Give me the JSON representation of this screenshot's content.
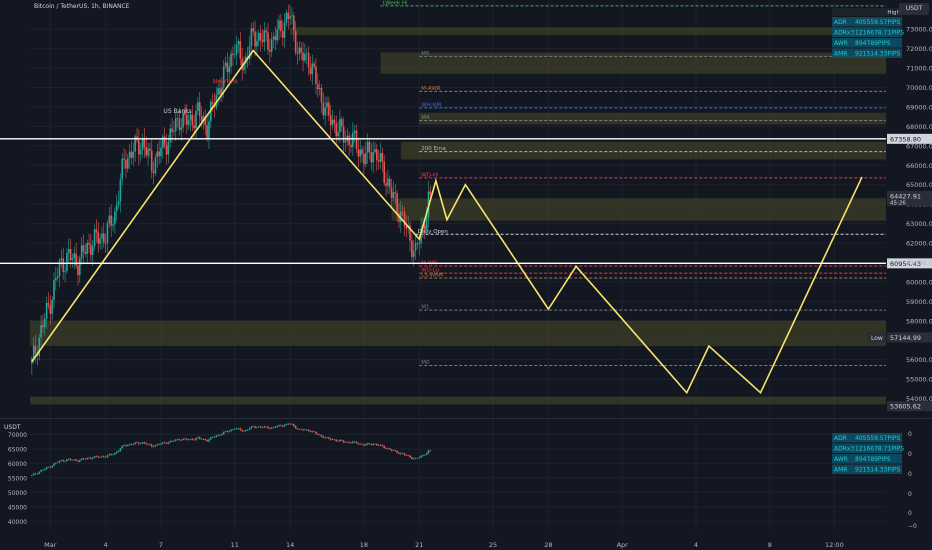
{
  "header": {
    "symbol_line": "Bitcoin / TetherUS, 1h, BINANCE",
    "currency": "USDT",
    "sub_currency": "USDT"
  },
  "stats": {
    "title": "High",
    "rows": [
      {
        "label": "ADR",
        "value": "405559.57PIPS"
      },
      {
        "label": "ADRx3",
        "value": "1216678.71PIPS"
      },
      {
        "label": "AWR",
        "value": "894789PIPS"
      },
      {
        "label": "AMR",
        "value": "921514.33PIPS"
      }
    ]
  },
  "chart_data": [
    {
      "type": "candlestick",
      "title": "Bitcoin / TetherUS, 1h, BINANCE",
      "ylabel": "USDT",
      "ylim": [
        53000,
        74500
      ],
      "y_ticks": [
        54000,
        55000,
        56000,
        57000,
        58000,
        59000,
        60000,
        61000,
        62000,
        63000,
        64000,
        65000,
        66000,
        67000,
        68000,
        69000,
        70000,
        71000,
        72000,
        73000
      ],
      "x_ticks": [
        "Mar",
        "4",
        "7",
        "11",
        "14",
        "18",
        "21",
        "25",
        "28",
        "Apr",
        "4",
        "8",
        "12:00"
      ],
      "x_tick_day": [
        0,
        3,
        6,
        10,
        13,
        17,
        20,
        24,
        27,
        31,
        35,
        39,
        42.5
      ],
      "xlim": [
        -1.1,
        45.3
      ],
      "close_path": [
        [
          -1.0,
          55800
        ],
        [
          -0.5,
          57500
        ],
        [
          0,
          59000
        ],
        [
          0.5,
          60800
        ],
        [
          1,
          61300
        ],
        [
          1.5,
          61000
        ],
        [
          2,
          61800
        ],
        [
          2.5,
          62200
        ],
        [
          3,
          62400
        ],
        [
          3.5,
          63500
        ],
        [
          4,
          66200
        ],
        [
          4.5,
          66800
        ],
        [
          5,
          67200
        ],
        [
          5.5,
          66000
        ],
        [
          6,
          66800
        ],
        [
          6.5,
          67500
        ],
        [
          7,
          68400
        ],
        [
          7.5,
          68200
        ],
        [
          8,
          68700
        ],
        [
          8.5,
          68000
        ],
        [
          9,
          69600
        ],
        [
          9.5,
          70800
        ],
        [
          10,
          72100
        ],
        [
          10.5,
          71200
        ],
        [
          11,
          72700
        ],
        [
          11.5,
          72500
        ],
        [
          12,
          72300
        ],
        [
          12.5,
          73100
        ],
        [
          13,
          73700
        ],
        [
          13.5,
          71600
        ],
        [
          14,
          71500
        ],
        [
          14.5,
          70000
        ],
        [
          15,
          68600
        ],
        [
          15.5,
          68000
        ],
        [
          16,
          67400
        ],
        [
          16.5,
          67200
        ],
        [
          17,
          66400
        ],
        [
          17.5,
          66800
        ],
        [
          18,
          65900
        ],
        [
          18.5,
          64500
        ],
        [
          19,
          63500
        ],
        [
          19.5,
          62200
        ],
        [
          19.8,
          61500
        ],
        [
          20.2,
          62800
        ],
        [
          20.5,
          64200
        ],
        [
          20.7,
          64000
        ]
      ],
      "levels": [
        {
          "label": "LWeek Hi",
          "value": 74200,
          "x_from": 17.9,
          "color": "#4caf50"
        },
        {
          "label": "M5",
          "value": 71600,
          "x_from": 20.0,
          "color": "#787b86"
        },
        {
          "label": "M-AWR",
          "value": 69800,
          "x_from": 20.0,
          "color": "#b07a3a"
        },
        {
          "label": "WH-WR",
          "value": 68950,
          "x_from": 20.0,
          "color": "#3a6fdf"
        },
        {
          "label": "M4",
          "value": 68300,
          "x_from": 20.0,
          "color": "#787b86"
        },
        {
          "label": "200 Ema",
          "value": 66700,
          "x_from": 20.0,
          "color": "#b2b5be"
        },
        {
          "label": "WD-Hi",
          "value": 65350,
          "x_from": 20.0,
          "color": "#f23645"
        },
        {
          "label": "Daily Open",
          "value": 62450,
          "x_from": 19.8,
          "color": "#d1d4dc"
        },
        {
          "label": "M-WR",
          "value": 60820,
          "x_from": 20.0,
          "color": "#f23645"
        },
        {
          "label": "WD-Lo",
          "value": 60450,
          "x_from": 20.0,
          "color": "#f23645"
        },
        {
          "label": "LS-WRM",
          "value": 60200,
          "x_from": 20.0,
          "color": "#b07a3a"
        },
        {
          "label": "M1",
          "value": 58550,
          "x_from": 20.0,
          "color": "#787b86"
        },
        {
          "label": "M0",
          "value": 55700,
          "x_from": 20.0,
          "color": "#787b86"
        }
      ],
      "zones": [
        {
          "from": 72700,
          "to": 73100,
          "x_from": 13.0
        },
        {
          "from": 70700,
          "to": 71800,
          "x_from": 17.9
        },
        {
          "from": 68100,
          "to": 68700,
          "x_from": 20.0
        },
        {
          "from": 66300,
          "to": 67200,
          "x_from": 19.0
        },
        {
          "from": 63150,
          "to": 64300,
          "x_from": 18.5
        },
        {
          "from": 57400,
          "to": 58000,
          "x_from": -1.1
        },
        {
          "from": 56700,
          "to": 57400,
          "x_from": -1.1
        },
        {
          "from": 53700,
          "to": 54100,
          "x_from": -1.1
        }
      ],
      "h_lines": [
        {
          "value": 67358.8,
          "label": "67358.80",
          "color": "#ffffff"
        },
        {
          "value": 60954.43,
          "label": "60954.43",
          "color": "#ffffff"
        }
      ],
      "price_tags": [
        {
          "value": 64427.91,
          "label": "64427.91",
          "sub": "45:26"
        },
        {
          "value": 57144.99,
          "label": "57144.99",
          "prefix": "Low"
        },
        {
          "value": 53605.62,
          "label": "53605.62"
        }
      ],
      "annotations": [
        {
          "text": "NewYork",
          "x": 9.5,
          "value": 70200,
          "color": "#f23645"
        },
        {
          "text": "US Banks",
          "x": 6.9,
          "value": 68700,
          "color": "#d1d4dc"
        }
      ],
      "projection_path": [
        [
          -1.0,
          55900
        ],
        [
          11.0,
          71900
        ],
        [
          20.0,
          62200
        ],
        [
          20.9,
          65200
        ],
        [
          21.5,
          63200
        ],
        [
          22.5,
          65000
        ],
        [
          27.0,
          58600
        ],
        [
          28.5,
          60800
        ],
        [
          34.5,
          54300
        ],
        [
          35.7,
          56700
        ],
        [
          38.5,
          54300
        ],
        [
          44.0,
          65400
        ]
      ]
    },
    {
      "type": "candlestick",
      "ylabel": "USDT",
      "ylim": [
        37000,
        75000
      ],
      "y_ticks": [
        40000,
        45000,
        50000,
        55000,
        60000,
        65000,
        70000
      ],
      "right_ticks": [
        "0",
        "0",
        "0",
        "0",
        "0",
        "−0"
      ],
      "x_ticks": [
        "Mar",
        "4",
        "7",
        "11",
        "14",
        "18",
        "21",
        "25",
        "28",
        "Apr",
        "4",
        "8",
        "12:00"
      ]
    }
  ]
}
